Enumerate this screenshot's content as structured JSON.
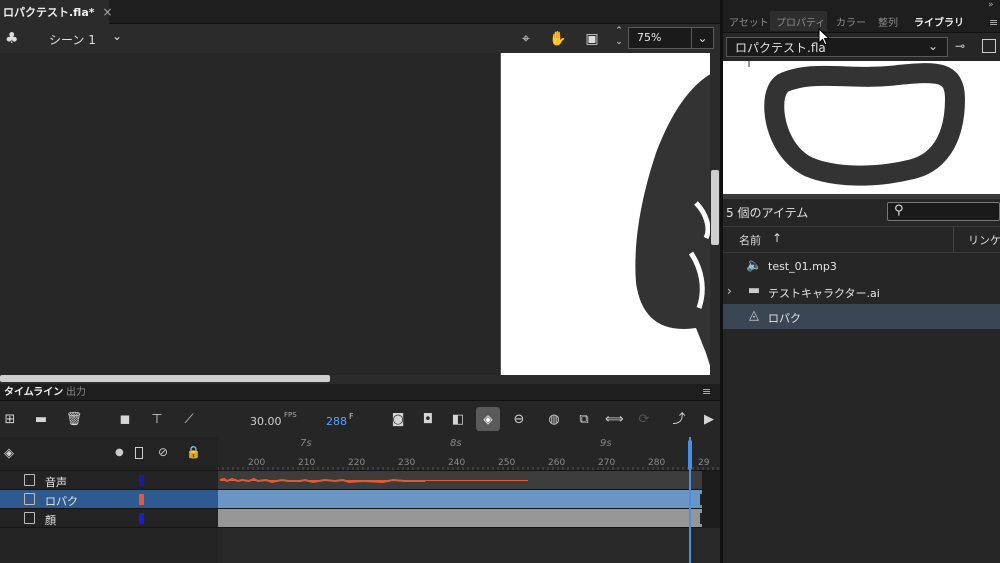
{
  "document": {
    "tab_title": "ロパクテスト.fla*",
    "close_glyph": "×"
  },
  "editbar": {
    "scene_label": "シーン 1",
    "zoom_value": "75%"
  },
  "timeline": {
    "tabs": [
      "タイムライン",
      "出力"
    ],
    "fps_value": "30.00",
    "fps_label": "FPS",
    "current_frame": "288",
    "frame_label": "F",
    "seconds_markers": [
      "7s",
      "8s",
      "9s"
    ],
    "frame_numbers": [
      "200",
      "210",
      "220",
      "230",
      "240",
      "250",
      "260",
      "270",
      "280",
      "29"
    ],
    "layers": [
      {
        "name": "音声",
        "color": "#1a1aa8",
        "selected": false
      },
      {
        "name": "ロパク",
        "color": "#e05a3a",
        "selected": true
      },
      {
        "name": "顔",
        "color": "#1a1ad8",
        "selected": false
      }
    ],
    "colors": {
      "playhead": "#4a90e2",
      "selected_row": "#2f5a8f"
    }
  },
  "right_panel": {
    "tabs": [
      "アセット",
      "プロパティ",
      "カラー",
      "整列",
      "ライブラリ"
    ],
    "active_tab": "ライブラリ",
    "library_select": "ロパクテスト.fla",
    "item_count": "5 個のアイテム",
    "columns": {
      "name": "名前",
      "linkage": "リンケージ"
    },
    "items": [
      {
        "label": "test_01.mp3",
        "icon": "sound-icon",
        "expandable": false,
        "selected": false
      },
      {
        "label": "テストキャラクター.ai",
        "icon": "folder-icon",
        "expandable": true,
        "selected": false
      },
      {
        "label": "ロパク",
        "icon": "graphic-symbol-icon",
        "expandable": false,
        "selected": true
      }
    ]
  }
}
